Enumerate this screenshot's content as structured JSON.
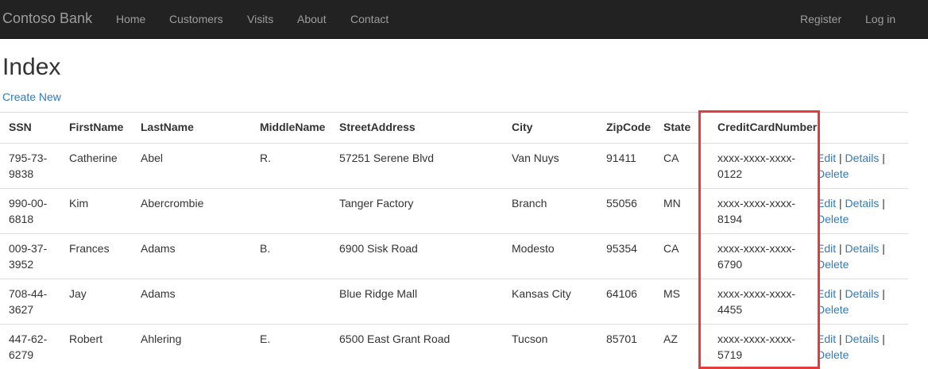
{
  "nav": {
    "brand": "Contoso Bank",
    "links": [
      "Home",
      "Customers",
      "Visits",
      "About",
      "Contact"
    ],
    "right_links": [
      "Register",
      "Log in"
    ]
  },
  "page": {
    "title": "Index",
    "create_new": "Create New"
  },
  "table": {
    "headers": [
      "SSN",
      "FirstName",
      "LastName",
      "MiddleName",
      "StreetAddress",
      "City",
      "ZipCode",
      "State",
      "CreditCardNumber"
    ],
    "action_labels": {
      "edit": "Edit",
      "details": "Details",
      "delete": "Delete",
      "separator": "|"
    },
    "rows": [
      {
        "ssn": [
          "795-73-",
          "9838"
        ],
        "first": "Catherine",
        "last": "Abel",
        "middle": "R.",
        "street": "57251 Serene Blvd",
        "city": "Van Nuys",
        "zip": "91411",
        "state": "CA",
        "cc": [
          "xxxx-xxxx-xxxx-",
          "0122"
        ]
      },
      {
        "ssn": [
          "990-00-",
          "6818"
        ],
        "first": "Kim",
        "last": "Abercrombie",
        "middle": "",
        "street": "Tanger Factory",
        "city": "Branch",
        "zip": "55056",
        "state": "MN",
        "cc": [
          "xxxx-xxxx-xxxx-",
          "8194"
        ]
      },
      {
        "ssn": [
          "009-37-",
          "3952"
        ],
        "first": "Frances",
        "last": "Adams",
        "middle": "B.",
        "street": "6900 Sisk Road",
        "city": "Modesto",
        "zip": "95354",
        "state": "CA",
        "cc": [
          "xxxx-xxxx-xxxx-",
          "6790"
        ]
      },
      {
        "ssn": [
          "708-44-",
          "3627"
        ],
        "first": "Jay",
        "last": "Adams",
        "middle": "",
        "street": "Blue Ridge Mall",
        "city": "Kansas City",
        "zip": "64106",
        "state": "MS",
        "cc": [
          "xxxx-xxxx-xxxx-",
          "4455"
        ]
      },
      {
        "ssn": [
          "447-62-",
          "6279"
        ],
        "first": "Robert",
        "last": "Ahlering",
        "middle": "E.",
        "street": "6500 East Grant Road",
        "city": "Tucson",
        "zip": "85701",
        "state": "AZ",
        "cc": [
          "xxxx-xxxx-xxxx-",
          "5719"
        ]
      }
    ]
  },
  "annotation": {
    "highlight_color": "#e33c3c",
    "highlighted_column": "CreditCardNumber"
  },
  "colors": {
    "navbar_bg": "#222222",
    "nav_text": "#9d9d9d",
    "link": "#337ab7",
    "border": "#dddddd"
  }
}
